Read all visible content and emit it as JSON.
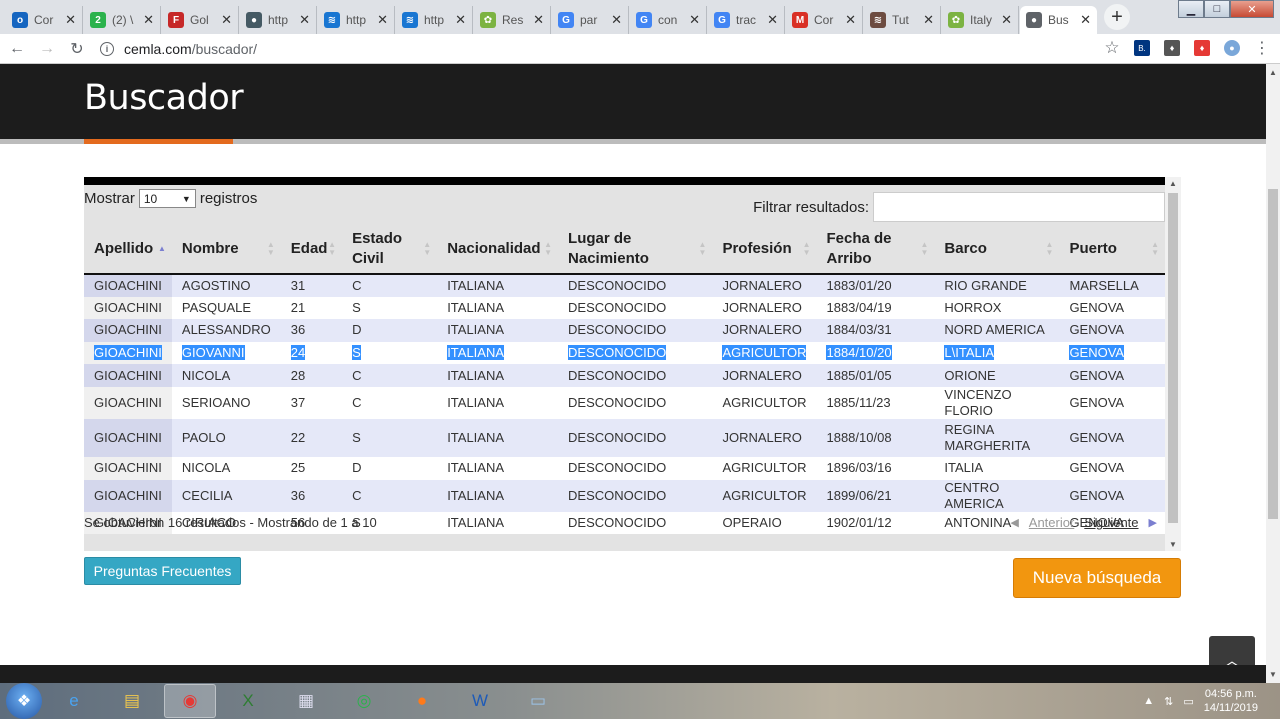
{
  "browser": {
    "tabs": [
      {
        "label": "Cor",
        "color": "#1565c0",
        "glyph": "o"
      },
      {
        "label": "(2) \\",
        "color": "#2bb24c",
        "glyph": "2"
      },
      {
        "label": "Gol",
        "color": "#c62828",
        "glyph": "F"
      },
      {
        "label": "http",
        "color": "#455a64",
        "glyph": "●"
      },
      {
        "label": "http",
        "color": "#1976d2",
        "glyph": "≋"
      },
      {
        "label": "http",
        "color": "#1976d2",
        "glyph": "≋"
      },
      {
        "label": "Res",
        "color": "#7cb342",
        "glyph": "✿"
      },
      {
        "label": "par",
        "color": "#4285f4",
        "glyph": "G"
      },
      {
        "label": "con",
        "color": "#4285f4",
        "glyph": "G"
      },
      {
        "label": "trac",
        "color": "#4285f4",
        "glyph": "G"
      },
      {
        "label": "Cor",
        "color": "#d93025",
        "glyph": "M"
      },
      {
        "label": "Tut",
        "color": "#6d4c41",
        "glyph": "≋"
      },
      {
        "label": "Italy",
        "color": "#7cb342",
        "glyph": "✿"
      },
      {
        "label": "Bus",
        "color": "#5f6368",
        "glyph": "●"
      }
    ],
    "active_tab": 13,
    "url_host": "cemla.com",
    "url_path": "/buscador/"
  },
  "page": {
    "title": "Buscador",
    "show_label_pre": "Mostrar",
    "show_value": "10",
    "show_label_post": "registros",
    "filter_label": "Filtrar resultados:",
    "columns": [
      "Apellido",
      "Nombre",
      "Edad",
      "Estado Civil",
      "Nacionalidad",
      "Lugar de Nacimiento",
      "Profesión",
      "Fecha de Arribo",
      "Barco",
      "Puerto"
    ],
    "rows": [
      [
        "GIOACHINI",
        "AGOSTINO",
        "31",
        "C",
        "ITALIANA",
        "DESCONOCIDO",
        "JORNALERO",
        "1883/01/20",
        "RIO GRANDE",
        "MARSELLA"
      ],
      [
        "GIOACHINI",
        "PASQUALE",
        "21",
        "S",
        "ITALIANA",
        "DESCONOCIDO",
        "JORNALERO",
        "1883/04/19",
        "HORROX",
        "GENOVA"
      ],
      [
        "GIOACHINI",
        "ALESSANDRO",
        "36",
        "D",
        "ITALIANA",
        "DESCONOCIDO",
        "JORNALERO",
        "1884/03/31",
        "NORD AMERICA",
        "GENOVA"
      ],
      [
        "GIOACHINI",
        "GIOVANNI",
        "24",
        "S",
        "ITALIANA",
        "DESCONOCIDO",
        "AGRICULTOR",
        "1884/10/20",
        "L\\ITALIA",
        "GENOVA"
      ],
      [
        "GIOACHINI",
        "NICOLA",
        "28",
        "C",
        "ITALIANA",
        "DESCONOCIDO",
        "JORNALERO",
        "1885/01/05",
        "ORIONE",
        "GENOVA"
      ],
      [
        "GIOACHINI",
        "SERIOANO",
        "37",
        "C",
        "ITALIANA",
        "DESCONOCIDO",
        "AGRICULTOR",
        "1885/11/23",
        "VINCENZO FLORIO",
        "GENOVA"
      ],
      [
        "GIOACHINI",
        "PAOLO",
        "22",
        "S",
        "ITALIANA",
        "DESCONOCIDO",
        "JORNALERO",
        "1888/10/08",
        "REGINA MARGHERITA",
        "GENOVA"
      ],
      [
        "GIOACHINI",
        "NICOLA",
        "25",
        "D",
        "ITALIANA",
        "DESCONOCIDO",
        "AGRICULTOR",
        "1896/03/16",
        "ITALIA",
        "GENOVA"
      ],
      [
        "GIOACHINI",
        "CECILIA",
        "36",
        "C",
        "ITALIANA",
        "DESCONOCIDO",
        "AGRICULTOR",
        "1899/06/21",
        "CENTRO AMERICA",
        "GENOVA"
      ],
      [
        "GIOACHINI",
        "CIRIACO",
        "56",
        "S",
        "ITALIANA",
        "DESCONOCIDO",
        "OPERAIO",
        "1902/01/12",
        "ANTONINA",
        "GENOVA"
      ]
    ],
    "selected_row": 3,
    "result_summary": "Se obtuvieron 16 resultados - Mostrando de 1 a 10",
    "prev_label": "Anterior",
    "next_label": "Siguiente",
    "faq_label": "Preguntas Frecuentes",
    "new_search_label": "Nueva búsqueda"
  },
  "taskbar": {
    "time": "04:56 p.m.",
    "date": "14/11/2019"
  }
}
